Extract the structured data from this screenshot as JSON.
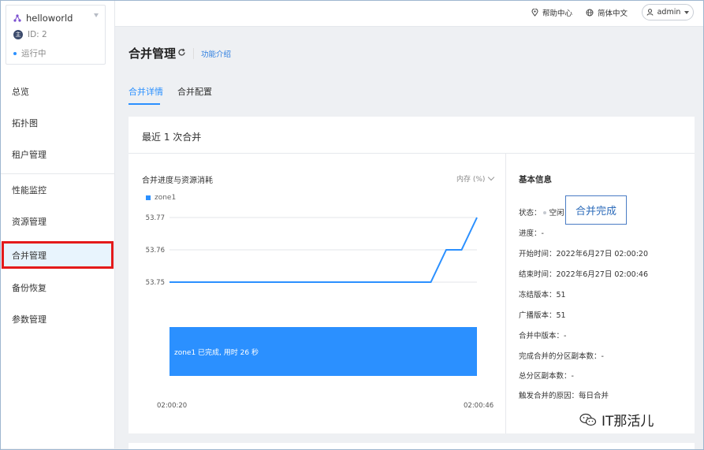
{
  "instance": {
    "name": "helloworld",
    "id_label": "ID: 2",
    "status": "运行中"
  },
  "nav": {
    "items": [
      {
        "label": "总览"
      },
      {
        "label": "拓扑图"
      },
      {
        "label": "租户管理"
      },
      {
        "label": "性能监控"
      },
      {
        "label": "资源管理"
      },
      {
        "label": "合并管理"
      },
      {
        "label": "备份恢复"
      },
      {
        "label": "参数管理"
      }
    ],
    "active": "合并管理"
  },
  "topbar": {
    "help": "帮助中心",
    "language": "简体中文",
    "user": "admin"
  },
  "page": {
    "title": "合并管理",
    "help_link": "功能介绍",
    "tabs": [
      {
        "label": "合并详情"
      },
      {
        "label": "合并配置"
      }
    ],
    "active_tab": "合并详情"
  },
  "card": {
    "title": "最近 1 次合并",
    "chart_panel_title": "合并进度与资源消耗",
    "metric_select": "内存 (%)",
    "progress_bar_text": "zone1 已完成, 用时 26 秒"
  },
  "chart_data": {
    "type": "line",
    "series": [
      {
        "name": "zone1",
        "x": [
          0,
          8.5,
          9,
          9.5,
          10
        ],
        "values": [
          53.75,
          53.75,
          53.76,
          53.76,
          53.77
        ]
      }
    ],
    "y_ticks": [
      "53.77",
      "53.76",
      "53.75"
    ],
    "ylim": [
      53.75,
      53.77
    ],
    "x_ticks": [
      "02:00:20",
      "02:00:46"
    ],
    "grid": true,
    "legend": "top-left",
    "color": "#2b90ff"
  },
  "basic_info": {
    "title": "基本信息",
    "rows": [
      {
        "label": "状态：",
        "value": "空闲"
      },
      {
        "label": "进度：",
        "value": "-"
      },
      {
        "label": "开始时间：",
        "value": "2022年6月27日 02:00:20"
      },
      {
        "label": "结束时间：",
        "value": "2022年6月27日 02:00:46"
      },
      {
        "label": "冻结版本：",
        "value": "51"
      },
      {
        "label": "广播版本：",
        "value": "51"
      },
      {
        "label": "合并中版本：",
        "value": "-"
      },
      {
        "label": "完成合并的分区副本数：",
        "value": "-"
      },
      {
        "label": "总分区副本数：",
        "value": "-"
      },
      {
        "label": "触发合并的原因：",
        "value": "每日合并"
      }
    ]
  },
  "callout": "合并完成",
  "watermark": "IT那活儿"
}
